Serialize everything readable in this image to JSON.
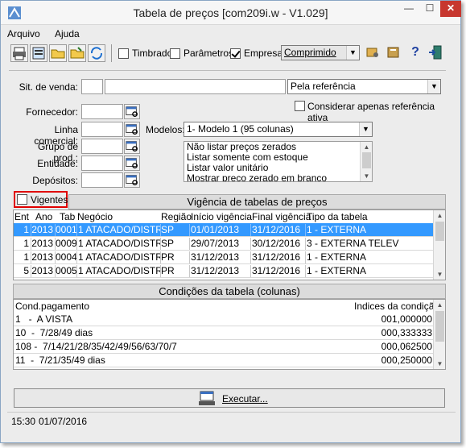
{
  "window": {
    "title": "Tabela de preços [com209i.w - V1.029]"
  },
  "menu": {
    "items": [
      "Arquivo",
      "Ajuda"
    ]
  },
  "toolbar": {
    "timbrado_label": "Timbrado",
    "parametros_label": "Parâmetros",
    "empresa_label": "Empresa",
    "timbrado_checked": false,
    "parametros_checked": false,
    "empresa_checked": true,
    "format_value": "Comprimido"
  },
  "filters": {
    "sit_venda_label": "Sit. de venda:",
    "ordem_value": "Pela referência",
    "considerar_label": "Considerar apenas referência ativa",
    "fornecedor_label": "Fornecedor:",
    "linha_label": "Linha comercial:",
    "grupo_label": "Grupo de prod.:",
    "entidade_label": "Entidade:",
    "depositos_label": "Depósitos:",
    "modelos_label": "Modelos:",
    "modelo_value": "1- Modelo 1 (95 colunas)",
    "options": [
      "Não listar preços zerados",
      "Listar somente com estoque",
      "Listar valor unitário",
      "Mostrar preço zerado em branco"
    ]
  },
  "vigencia": {
    "vigentes_label": "Vigentes",
    "title": "Vigência de tabelas de preços",
    "columns": [
      "Ent",
      "Ano",
      "Tab",
      "Negócio",
      "Região",
      "Início vigência",
      "Final vigência",
      "Tipo da tabela"
    ],
    "rows": [
      [
        "1",
        "2013",
        "0001",
        "1 ATACADO/DISTRI",
        "SP",
        "01/01/2013",
        "31/12/2016",
        "1 - EXTERNA"
      ],
      [
        "1",
        "2013",
        "0009",
        "1 ATACADO/DISTRI",
        "SP",
        "29/07/2013",
        "30/12/2016",
        "3 - EXTERNA TELEV"
      ],
      [
        "1",
        "2013",
        "0004",
        "1 ATACADO/DISTRI",
        "PR",
        "31/12/2013",
        "31/12/2016",
        "1 - EXTERNA"
      ],
      [
        "5",
        "2013",
        "0005",
        "1 ATACADO/DISTRI",
        "PR",
        "31/12/2013",
        "31/12/2016",
        "1 - EXTERNA"
      ]
    ]
  },
  "condicoes": {
    "title": "Condições da tabela (colunas)",
    "col_cond": "Cond.pagamento",
    "col_indices": "Indices da condição",
    "rows": [
      [
        "1   -  A VISTA",
        "001,000000"
      ],
      [
        "10  -  7/28/49 dias",
        "000,333333"
      ],
      [
        "108 -  7/14/21/28/35/42/49/56/63/70/7",
        "000,062500"
      ],
      [
        "11  -  7/21/35/49 dias",
        "000,250000"
      ]
    ]
  },
  "executar_label": "Executar...",
  "status": {
    "time": "15:30",
    "date": "01/07/2016"
  }
}
